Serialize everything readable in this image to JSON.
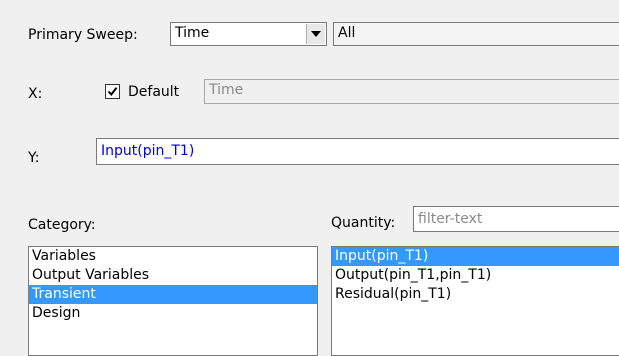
{
  "primary_sweep": {
    "label": "Primary Sweep:",
    "value": "Time",
    "all_value": "All"
  },
  "x": {
    "label": "X:",
    "default_label": "Default",
    "default_checked": true,
    "value": "Time"
  },
  "y": {
    "label": "Y:",
    "value": "Input(pin_T1)"
  },
  "category": {
    "label": "Category:",
    "items": [
      "Variables",
      "Output Variables",
      "Transient",
      "Design"
    ],
    "selected": "Transient"
  },
  "quantity": {
    "label": "Quantity:",
    "filter_placeholder": "filter-text",
    "items": [
      "Input(pin_T1)",
      "Output(pin_T1,pin_T1)",
      "Residual(pin_T1)"
    ],
    "selected": "Input(pin_T1)"
  },
  "colors": {
    "selection": "#3399ff",
    "expression_text": "#0000d0"
  }
}
